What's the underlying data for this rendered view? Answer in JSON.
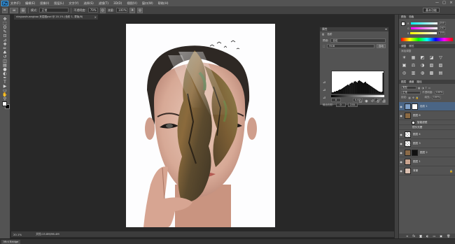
{
  "app": {
    "logo": "Ps",
    "menu": [
      "文件(F)",
      "编辑(E)",
      "图像(I)",
      "图层(L)",
      "文字(Y)",
      "选择(S)",
      "滤镜(T)",
      "3D(D)",
      "视图(V)",
      "窗口(W)",
      "帮助(H)"
    ],
    "window_controls": [
      "—",
      "□",
      "×"
    ]
  },
  "options_bar": {
    "brush_size": "46",
    "mode_label": "模式:",
    "mode_value": "正常",
    "opacity_label": "不透明度:",
    "opacity_value": "79%",
    "flow_label": "流量:",
    "flow_value": "100%",
    "workspace": "基本功能"
  },
  "document_tab": {
    "title": "nieguoshuangbao 夹层图psd @ 20.1% (色阶 1, 蒙版/8)",
    "close": "×"
  },
  "tools": {
    "icons": [
      "move-icon",
      "marquee-icon",
      "lasso-icon",
      "quick-select-icon",
      "crop-icon",
      "eyedropper-icon",
      "healing-icon",
      "brush-icon",
      "clone-stamp-icon",
      "history-brush-icon",
      "eraser-icon",
      "gradient-icon",
      "blur-icon",
      "dodge-icon",
      "pen-icon",
      "type-icon",
      "path-select-icon",
      "shape-icon",
      "hand-icon",
      "zoom-icon"
    ],
    "glyphs": [
      "✥",
      "⬚",
      "ʘ",
      "✎",
      "⊡",
      "⊿",
      "✚",
      "✏",
      "♣",
      "↺",
      "◫",
      "▤",
      "●",
      "◐",
      "✒",
      "T",
      "▶",
      "▭",
      "✋",
      "⚲"
    ],
    "foreground": "#ffffff",
    "background": "#000000"
  },
  "status_bar": {
    "zoom": "20.1%",
    "doc_info": "文档:15.8M/96.4M"
  },
  "bridge_tab": "Mini Bridge",
  "properties_panel": {
    "title": "属性",
    "tabs": [
      "色阶"
    ],
    "preset_label": "预设:",
    "preset_value": "自定",
    "channel_value": "RGB",
    "auto_button": "自动",
    "input_values": [
      "0",
      "0.87",
      "255"
    ],
    "output_label": "输出色阶:",
    "output_values": [
      "0",
      "255"
    ],
    "histogram": [
      2,
      2,
      3,
      3,
      4,
      4,
      5,
      6,
      6,
      7,
      8,
      9,
      10,
      11,
      12,
      13,
      12,
      14,
      15,
      16,
      15,
      17,
      18,
      17,
      16,
      18,
      19,
      18,
      17,
      16,
      15,
      16,
      17,
      15,
      14,
      13,
      12,
      11,
      10,
      9,
      8,
      7,
      6,
      5,
      4,
      3,
      3,
      2,
      3,
      30
    ]
  },
  "color_panel": {
    "tabs": [
      "颜色",
      "色板"
    ],
    "channels": [
      {
        "label": "R",
        "value": "255",
        "track": "linear-gradient(to right,#00ffff,#ffffff)"
      },
      {
        "label": "G",
        "value": "247",
        "track": "linear-gradient(to right,#ff00ff,#ffffff)"
      },
      {
        "label": "B",
        "value": "255",
        "track": "linear-gradient(to right,#ffff00,#ffffff)"
      }
    ]
  },
  "adjustments_panel": {
    "tabs": [
      "调整",
      "样式"
    ],
    "heading": "添加调整",
    "icons": [
      "☀",
      "▦",
      "◩",
      "◪",
      "▽",
      "▣",
      "⚖",
      "◑",
      "▧",
      "▨",
      "◎",
      "▥",
      "◍",
      "▩",
      "▤"
    ]
  },
  "layers_panel": {
    "tabs": [
      "图层",
      "通道",
      "路径"
    ],
    "kind_value": "类型",
    "blend_value": "正常",
    "opacity_label": "不透明度:",
    "opacity_value": "100%",
    "lock_label": "锁定:",
    "fill_label": "填充:",
    "fill_value": "100%",
    "layers": [
      {
        "name": "色阶 1",
        "selected": true,
        "sub": false,
        "thumb": "#7fa0c8",
        "mask": "#ffffff"
      },
      {
        "name": "图层 6",
        "selected": false,
        "sub": false,
        "thumb": "#8b6a44",
        "mask": ""
      },
      {
        "name": "智能滤镜",
        "selected": false,
        "sub": true,
        "thumb": "#ffffff",
        "mask": ""
      },
      {
        "name": "镜头光晕",
        "selected": false,
        "sub": true,
        "thumb": "",
        "mask": ""
      },
      {
        "name": "图层 4",
        "selected": false,
        "sub": false,
        "thumb": "checker",
        "mask": ""
      },
      {
        "name": "图层 3",
        "selected": false,
        "sub": false,
        "thumb": "checker",
        "mask": ""
      },
      {
        "name": "图层 2",
        "selected": false,
        "sub": false,
        "thumb": "#8a6a48",
        "mask": "#111111"
      },
      {
        "name": "图层 1",
        "selected": false,
        "sub": false,
        "thumb": "#c9a48f",
        "mask": ""
      },
      {
        "name": "背景",
        "selected": false,
        "sub": false,
        "thumb": "#d9bfb0",
        "mask": "",
        "locked": true
      }
    ],
    "footer_icons": [
      "∞",
      "fx",
      "◙",
      "◐",
      "▭",
      "▣",
      "🗑"
    ]
  }
}
